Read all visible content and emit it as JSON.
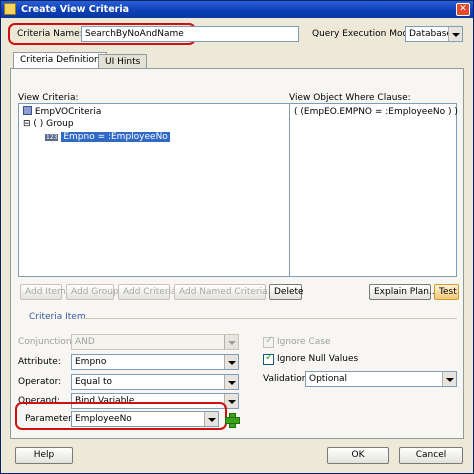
{
  "window": {
    "title": "Create View Criteria",
    "close_glyph": "✕"
  },
  "header": {
    "criteria_name_label": "Criteria Name:",
    "criteria_name_value": "SearchByNoAndName",
    "query_mode_label": "Query Execution Mode:",
    "query_mode_value": "Database"
  },
  "tabs": [
    {
      "label": "Criteria Definition",
      "selected": true
    },
    {
      "label": "UI Hints",
      "selected": false
    }
  ],
  "view_criteria": {
    "label": "View Criteria:",
    "tree": {
      "root": "EmpVOCriteria",
      "group_toggle": "⊟",
      "group_label": "( ) Group",
      "item_tag": "123",
      "item": "Empno = :EmployeeNo"
    }
  },
  "where_clause": {
    "label": "View Object Where Clause:",
    "text": "( (EmpEO.EMPNO = :EmployeeNo ) )"
  },
  "buttons": {
    "add_item": "Add Item",
    "add_group": "Add Group",
    "add_criteria": "Add Criteria",
    "add_named_criteria": "Add Named Criteria...",
    "delete": "Delete",
    "explain_plan": "Explain Plan...",
    "test": "Test",
    "help": "Help",
    "ok": "OK",
    "cancel": "Cancel"
  },
  "criteria_item": {
    "section_label": "Criteria Item",
    "conjunction_label": "Conjunction:",
    "conjunction_value": "AND",
    "attribute_label": "Attribute:",
    "attribute_value": "Empno",
    "operator_label": "Operator:",
    "operator_value": "Equal to",
    "operand_label": "Operand:",
    "operand_value": "Bind Variable",
    "parameter_label": "Parameter:",
    "parameter_value": "EmployeeNo",
    "ignore_case_label": "Ignore Case",
    "ignore_case_checked": true,
    "ignore_nulls_label": "Ignore Null Values",
    "ignore_nulls_checked": true,
    "validation_label": "Validation:",
    "validation_value": "Optional"
  },
  "colors": {
    "highlight": "#d01010",
    "selection": "#316ac5",
    "titlebar": "#0c3fb5"
  }
}
